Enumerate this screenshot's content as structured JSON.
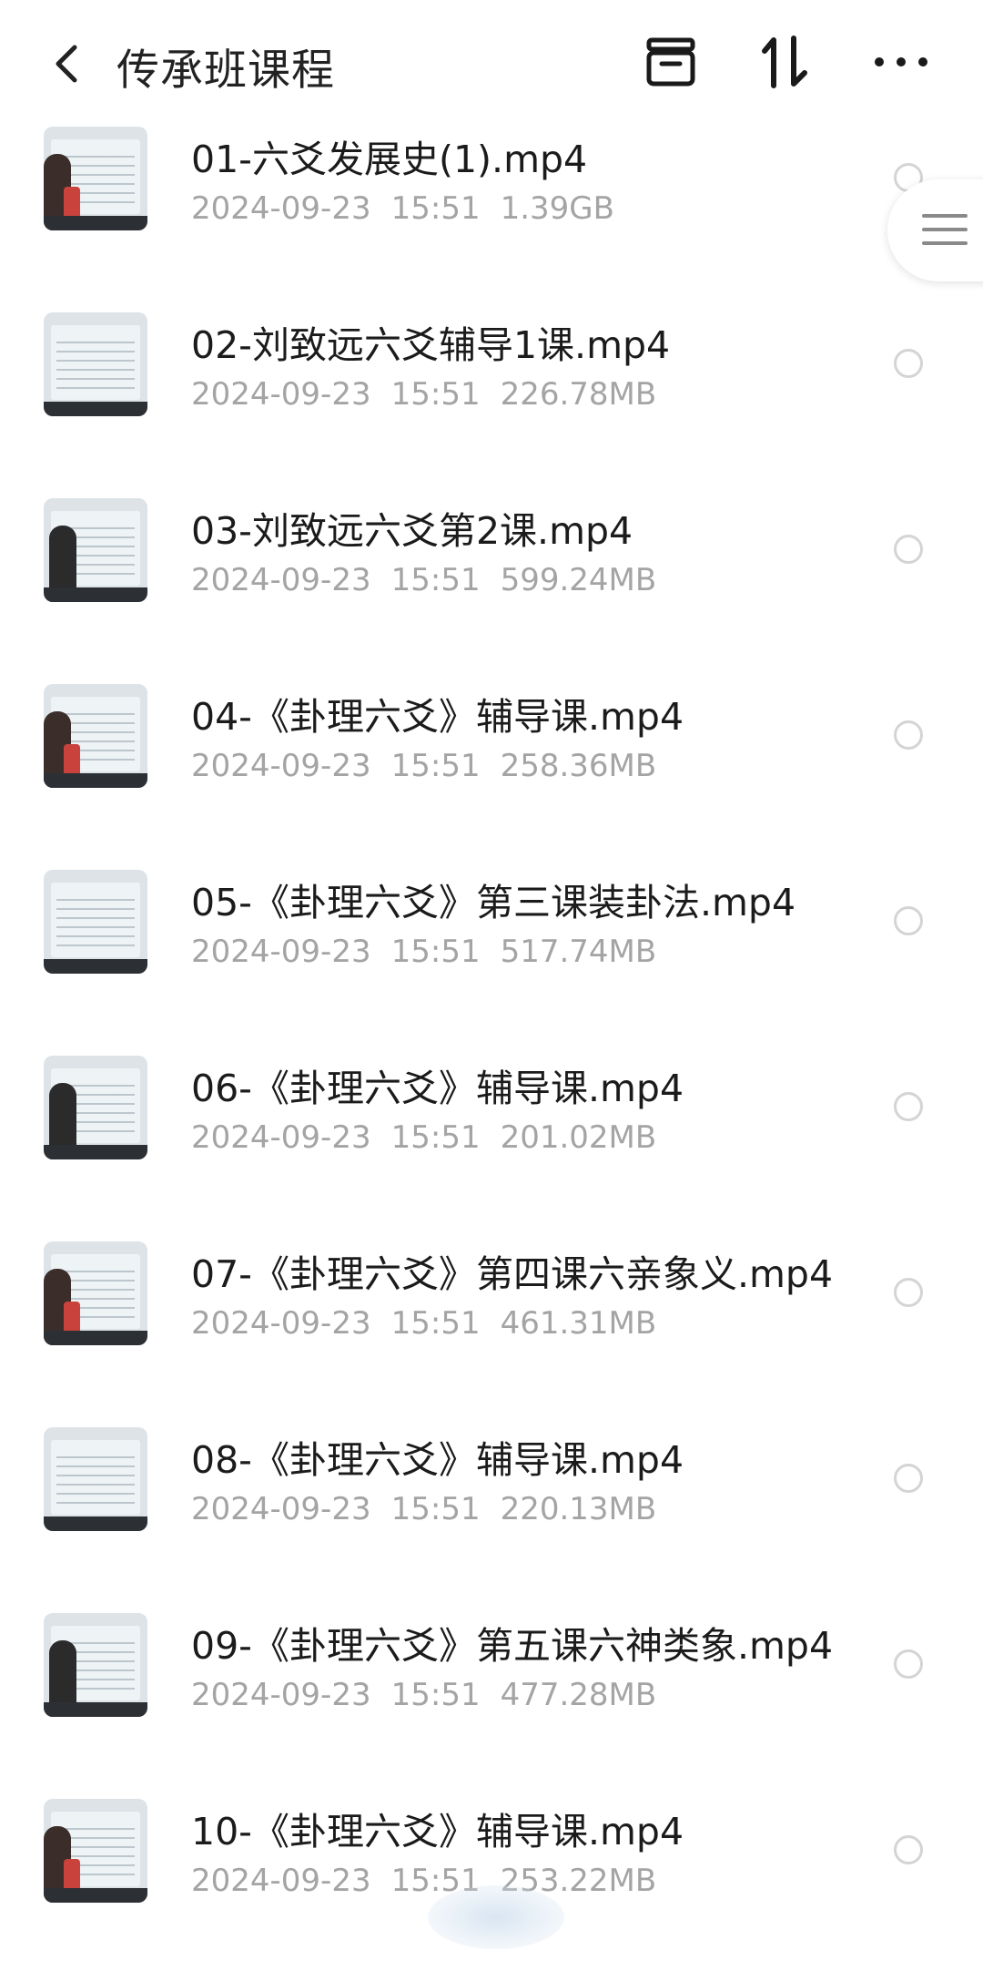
{
  "header": {
    "back_icon": "chevron-left-icon",
    "title": "传承班课程",
    "icons": [
      "archive-box-icon",
      "sort-icon",
      "more-horizontal-icon"
    ]
  },
  "files": [
    {
      "name": "01-六爻发展史(1).mp4",
      "date": "2024-09-23",
      "time": "15:51",
      "size": "1.39GB"
    },
    {
      "name": "02-刘致远六爻辅导1课.mp4",
      "date": "2024-09-23",
      "time": "15:51",
      "size": "226.78MB"
    },
    {
      "name": "03-刘致远六爻第2课.mp4",
      "date": "2024-09-23",
      "time": "15:51",
      "size": "599.24MB"
    },
    {
      "name": "04-《卦理六爻》辅导课.mp4",
      "date": "2024-09-23",
      "time": "15:51",
      "size": "258.36MB"
    },
    {
      "name": "05-《卦理六爻》第三课装卦法.mp4",
      "date": "2024-09-23",
      "time": "15:51",
      "size": "517.74MB"
    },
    {
      "name": "06-《卦理六爻》辅导课.mp4",
      "date": "2024-09-23",
      "time": "15:51",
      "size": "201.02MB"
    },
    {
      "name": "07-《卦理六爻》第四课六亲象义.mp4",
      "date": "2024-09-23",
      "time": "15:51",
      "size": "461.31MB"
    },
    {
      "name": "08-《卦理六爻》辅导课.mp4",
      "date": "2024-09-23",
      "time": "15:51",
      "size": "220.13MB"
    },
    {
      "name": "09-《卦理六爻》第五课六神类象.mp4",
      "date": "2024-09-23",
      "time": "15:51",
      "size": "477.28MB"
    },
    {
      "name": "10-《卦理六爻》辅导课.mp4",
      "date": "2024-09-23",
      "time": "15:51",
      "size": "253.22MB"
    }
  ],
  "side_handle_icon": "menu-lines-icon"
}
